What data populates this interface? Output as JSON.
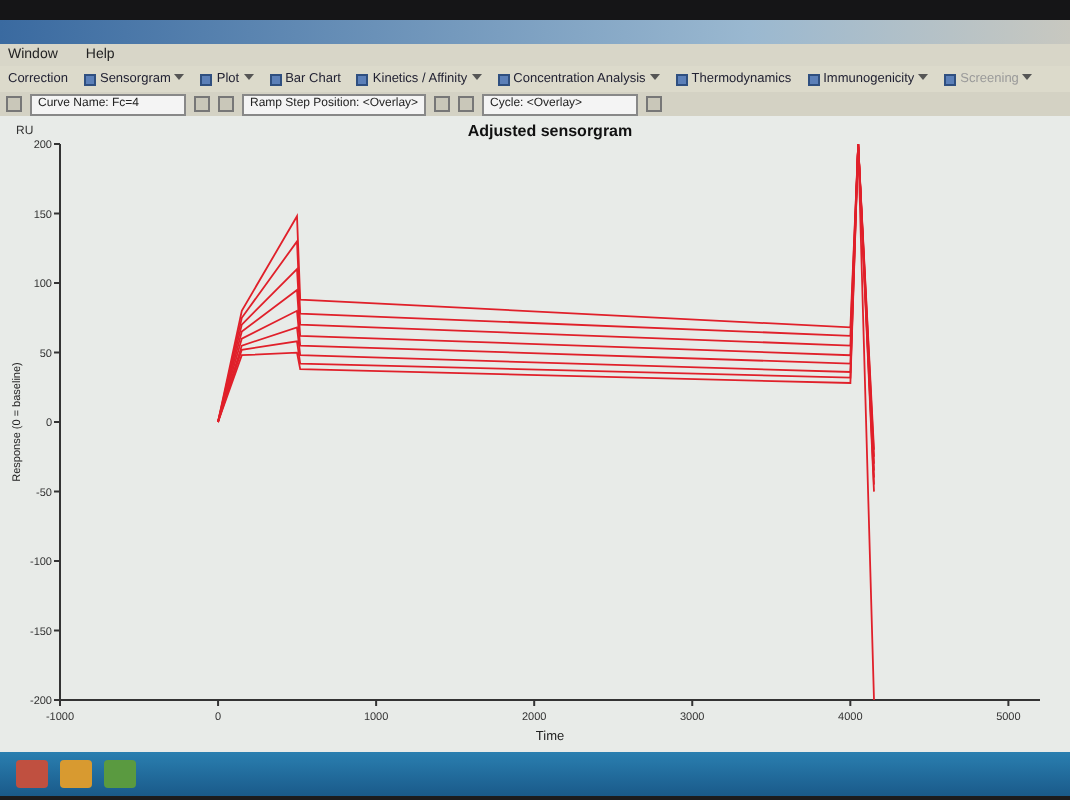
{
  "menu_bar": {
    "items": [
      "Window",
      "Help"
    ]
  },
  "toolbar": {
    "items": [
      {
        "label": "Correction",
        "kind": "text",
        "disabled": false
      },
      {
        "label": "Sensorgram",
        "kind": "dropdown",
        "disabled": false
      },
      {
        "label": "Plot",
        "kind": "dropdown",
        "disabled": false
      },
      {
        "label": "Bar Chart",
        "kind": "button",
        "disabled": false
      },
      {
        "label": "Kinetics / Affinity",
        "kind": "dropdown",
        "disabled": false
      },
      {
        "label": "Concentration Analysis",
        "kind": "dropdown",
        "disabled": false
      },
      {
        "label": "Thermodynamics",
        "kind": "button",
        "disabled": false
      },
      {
        "label": "Immunogenicity",
        "kind": "dropdown",
        "disabled": false
      },
      {
        "label": "Screening",
        "kind": "dropdown",
        "disabled": true
      }
    ]
  },
  "selectors": [
    {
      "value": "Curve Name: Fc=4"
    },
    {
      "value": "Ramp Step Position: <Overlay>"
    },
    {
      "value": "Cycle: <Overlay>"
    }
  ],
  "chart": {
    "unit": "RU",
    "chart_data": {
      "type": "line",
      "title": "Adjusted sensorgram",
      "xlabel": "Time",
      "ylabel": "Response (0 = baseline)",
      "x": [
        0,
        150,
        500,
        520,
        4000,
        4050,
        4150
      ],
      "xlim": [
        -1000,
        5200
      ],
      "ylim": [
        -200,
        200
      ],
      "xticks": [
        -1000,
        0,
        1000,
        2000,
        3000,
        4000,
        5000
      ],
      "yticks": [
        -200,
        -150,
        -100,
        -50,
        0,
        50,
        100,
        150,
        200
      ],
      "series": [
        {
          "color": "#e0202a",
          "values": [
            0,
            80,
            148,
            88,
            68,
            200,
            -20
          ]
        },
        {
          "color": "#e0202a",
          "values": [
            0,
            75,
            130,
            78,
            62,
            200,
            -25
          ]
        },
        {
          "color": "#e0202a",
          "values": [
            0,
            70,
            110,
            70,
            55,
            200,
            -30
          ]
        },
        {
          "color": "#e0202a",
          "values": [
            0,
            65,
            95,
            62,
            48,
            200,
            -35
          ]
        },
        {
          "color": "#e0202a",
          "values": [
            0,
            60,
            80,
            55,
            42,
            200,
            -40
          ]
        },
        {
          "color": "#e0202a",
          "values": [
            0,
            55,
            68,
            48,
            36,
            200,
            -45
          ]
        },
        {
          "color": "#e0202a",
          "values": [
            0,
            52,
            58,
            42,
            32,
            200,
            -50
          ]
        },
        {
          "color": "#e0202a",
          "values": [
            0,
            48,
            50,
            38,
            28,
            200,
            -200
          ]
        }
      ]
    }
  }
}
